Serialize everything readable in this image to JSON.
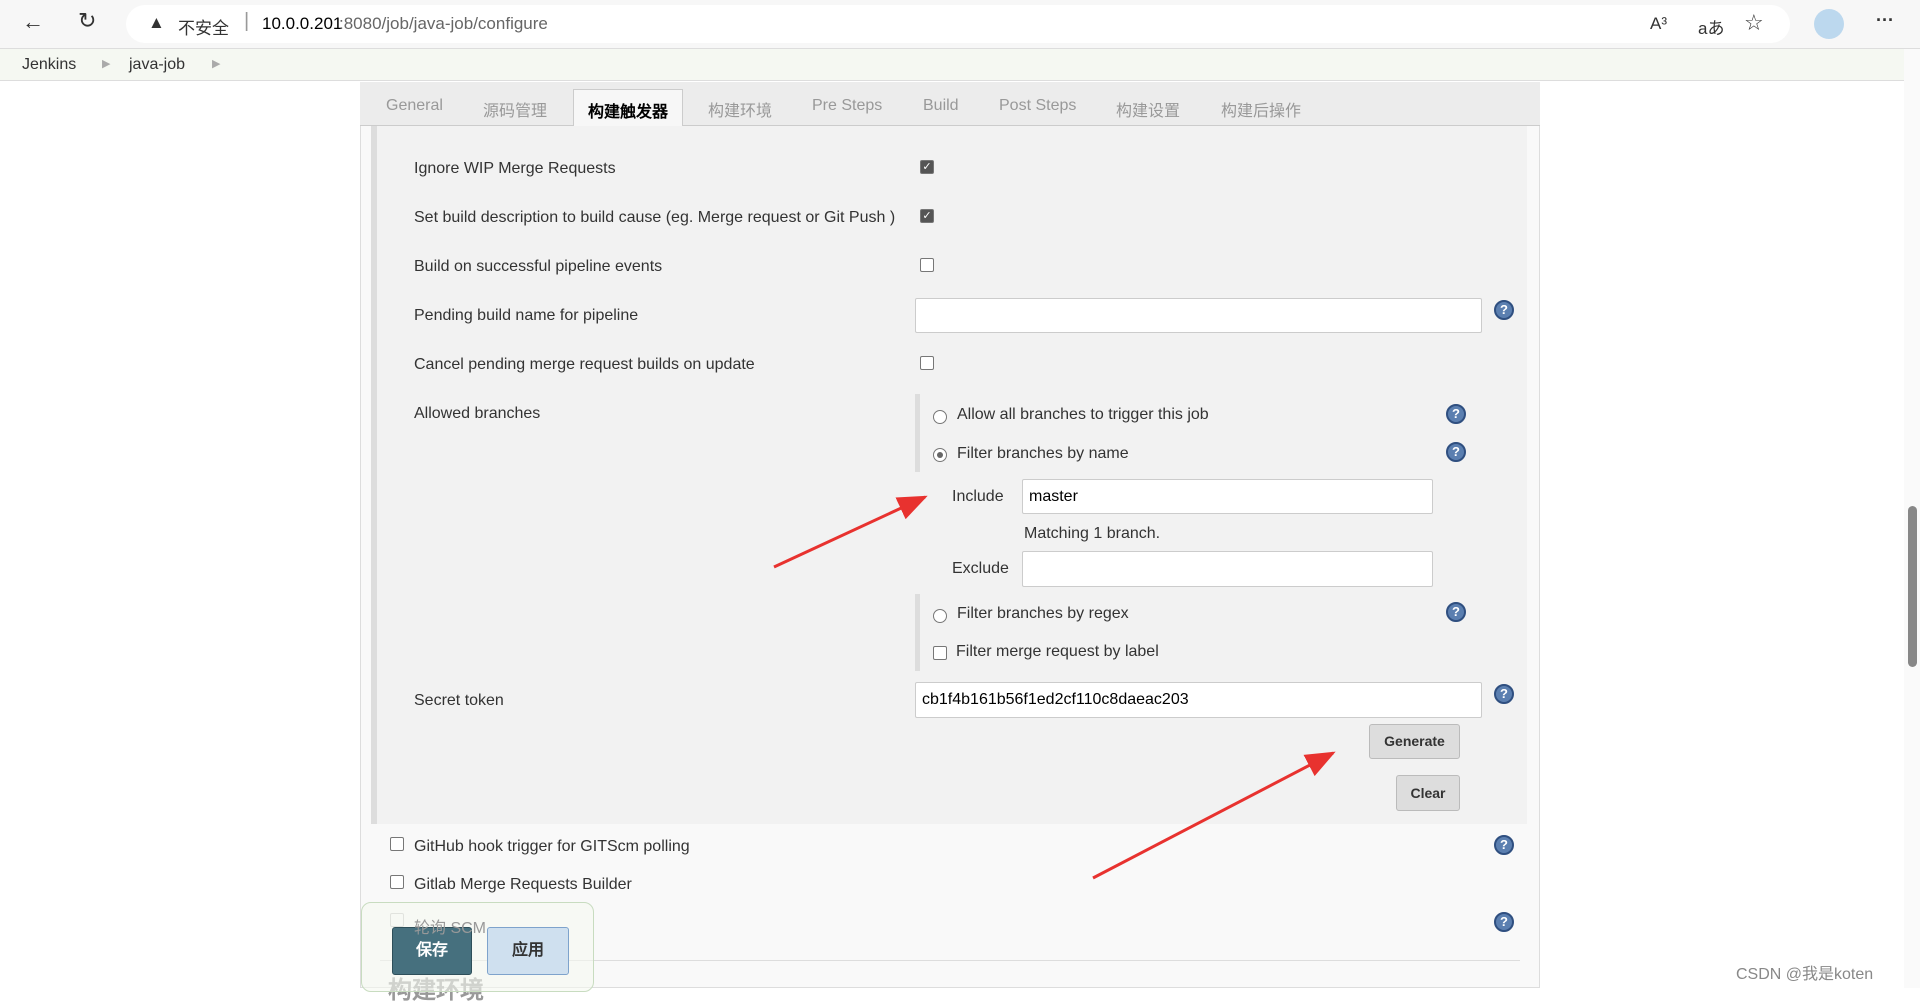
{
  "browser": {
    "security": "不安全",
    "url_host": "10.0.0.201",
    "url_path": ":8080/job/java-job/configure",
    "read_aloud": "A³",
    "translate": "aあ",
    "favorite": "☆",
    "more": "···"
  },
  "breadcrumb": [
    "Jenkins",
    "java-job"
  ],
  "tabs": [
    "General",
    "源码管理",
    "构建触发器",
    "构建环境",
    "Pre Steps",
    "Build",
    "Post Steps",
    "构建设置",
    "构建后操作"
  ],
  "active_tab": "构建触发器",
  "options": {
    "ignore_wip": {
      "label": "Ignore WIP Merge Requests",
      "checked": true
    },
    "set_desc": {
      "label": "Set build description to build cause (eg. Merge request or Git Push )",
      "checked": true
    },
    "pipeline_events": {
      "label": "Build on successful pipeline events",
      "checked": false
    },
    "pending_name": {
      "label": "Pending build name for pipeline",
      "value": ""
    },
    "cancel_pending": {
      "label": "Cancel pending merge request builds on update",
      "checked": false
    }
  },
  "allowed_branches": {
    "label": "Allowed branches",
    "allow_all": "Allow all branches to trigger this job",
    "filter_name": "Filter branches by name",
    "include_label": "Include",
    "include_value": "master",
    "matching": "Matching 1 branch.",
    "exclude_label": "Exclude",
    "exclude_value": "",
    "filter_regex": "Filter branches by regex",
    "filter_label": "Filter merge request by label",
    "selected": "Filter branches by name"
  },
  "secret": {
    "label": "Secret token",
    "value": "cb1f4b161b56f1ed2cf110c8daeac203",
    "generate": "Generate",
    "clear": "Clear"
  },
  "triggers": [
    {
      "label": "GitHub hook trigger for GITScm polling",
      "checked": false
    },
    {
      "label": "Gitlab Merge Requests Builder",
      "checked": false
    },
    {
      "label": "轮询 SCM",
      "checked": false
    }
  ],
  "next_section": "构建环境",
  "save": "保存",
  "apply": "应用",
  "watermark": "CSDN @我是koten",
  "colors": {
    "save": "#46707e",
    "apply": "#cfe0ef",
    "arrow": "#e8322f"
  }
}
